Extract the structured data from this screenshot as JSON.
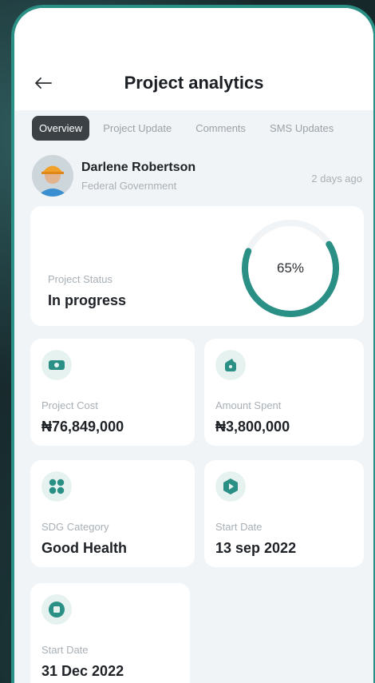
{
  "header": {
    "title": "Project analytics"
  },
  "tabs": [
    {
      "label": "Overview",
      "active": true
    },
    {
      "label": "Project Update",
      "active": false
    },
    {
      "label": "Comments",
      "active": false
    },
    {
      "label": "SMS Updates",
      "active": false
    }
  ],
  "profile": {
    "name": "Darlene Robertson",
    "organization": "Federal Government",
    "time": "2 days ago"
  },
  "status": {
    "label": "Project Status",
    "value": "In progress",
    "progress_percent": 65,
    "progress_text": "65%"
  },
  "cards": [
    {
      "icon": "money-icon",
      "label": "Project Cost",
      "value": "₦76,849,000"
    },
    {
      "icon": "wallet-icon",
      "label": "Amount Spent",
      "value": "₦3,800,000"
    },
    {
      "icon": "grid-icon",
      "label": "SDG Category",
      "value": "Good Health"
    },
    {
      "icon": "start-hex-icon",
      "label": "Start Date",
      "value": "13 sep 2022"
    },
    {
      "icon": "stop-circle-icon",
      "label": "Start Date",
      "value": "31 Dec 2022"
    }
  ],
  "colors": {
    "accent": "#2a8f85",
    "tab_active_bg": "#3b4145",
    "background": "#f1f4f6"
  }
}
